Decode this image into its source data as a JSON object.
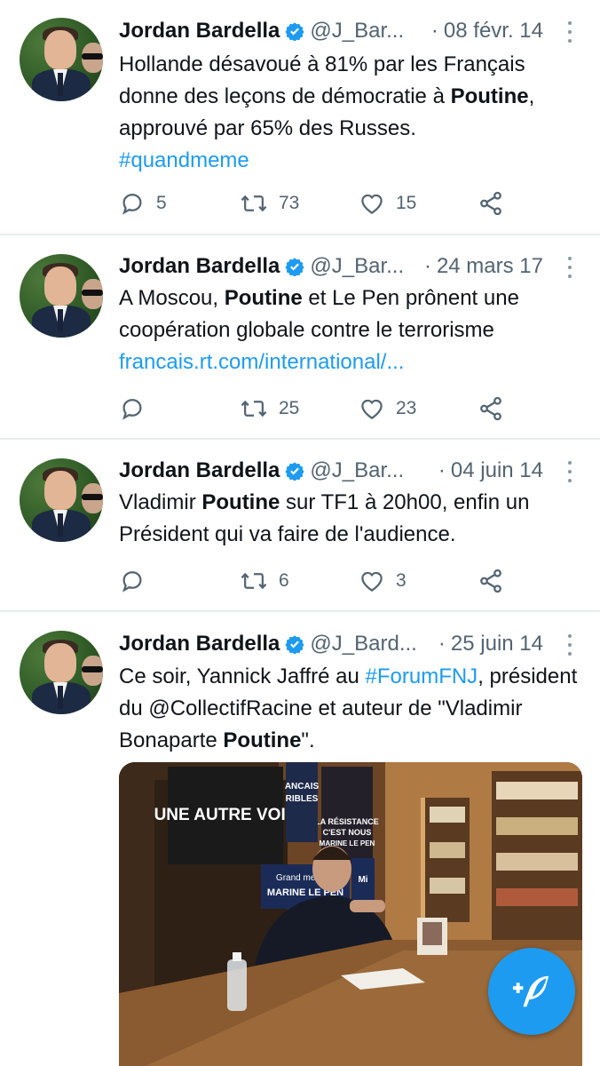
{
  "tweets": [
    {
      "name": "Jordan Bardella",
      "handle": "@J_Bar...",
      "date": "08 févr. 14",
      "text_parts": [
        "Hollande désavoué à 81% par les Français donne des leçons de démocratie à ",
        "Poutine",
        ", approuvé par 65% des Russes."
      ],
      "hashtag": "#quandmeme",
      "replies": "5",
      "retweets": "73",
      "likes": "15"
    },
    {
      "name": "Jordan Bardella",
      "handle": "@J_Bar...",
      "date": "24 mars 17",
      "text_parts": [
        "A Moscou, ",
        "Poutine",
        " et Le Pen prônent une coopération globale contre le terrorisme"
      ],
      "link": "francais.rt.com/international/...",
      "replies": "",
      "retweets": "25",
      "likes": "23"
    },
    {
      "name": "Jordan Bardella",
      "handle": "@J_Bar...",
      "date": "04 juin 14",
      "text_parts": [
        "Vladimir ",
        "Poutine",
        " sur TF1 à 20h00, enfin un Président qui va faire de l'audience."
      ],
      "replies": "",
      "retweets": "6",
      "likes": "3"
    },
    {
      "name": "Jordan Bardella",
      "handle": "@J_Bard...",
      "date": "25 juin 14",
      "text_parts": [
        "Ce soir, Yannick Jaffré au ",
        "#ForumFNJ",
        ", président du @CollectifRacine et auteur de \"Vladimir Bonaparte ",
        "Poutine",
        "\"."
      ],
      "media": {
        "poster1": "UNE AUTRE VOIX",
        "poster2_lines": [
          "LA RÉSISTANCE",
          "C'EST NOUS",
          "MARINE LE PEN"
        ],
        "poster3_lines": [
          "Grand meeting",
          "MARINE LE PEN"
        ],
        "poster4_lines": [
          "ANCAIS",
          "RIBLES"
        ],
        "poster5": "Mi"
      }
    }
  ],
  "colors": {
    "link": "#1d9bf0",
    "muted": "#536471",
    "fab": "#1d9bf0"
  },
  "icons": {
    "verified": "verified-badge-icon",
    "reply": "reply-icon",
    "retweet": "retweet-icon",
    "like": "heart-icon",
    "share": "share-icon",
    "more": "more-vertical-icon",
    "compose": "compose-tweet-icon"
  }
}
